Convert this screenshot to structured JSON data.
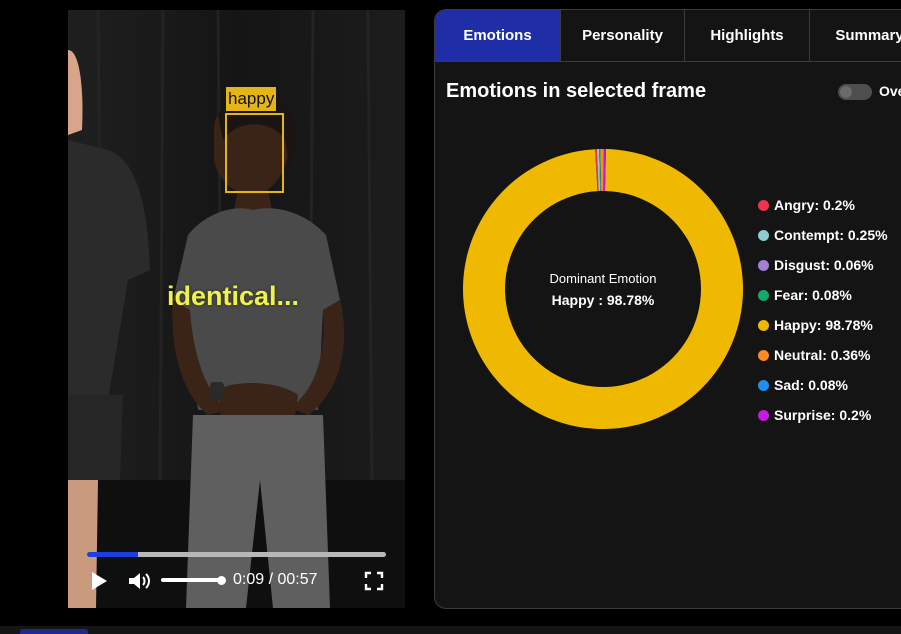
{
  "video": {
    "face_label": "happy",
    "caption": "identical...",
    "time_current": "0:09",
    "time_total": "00:57",
    "progress": 0.17,
    "volume": 0.95
  },
  "tabs": [
    {
      "label": "Emotions",
      "active": true
    },
    {
      "label": "Personality",
      "active": false
    },
    {
      "label": "Highlights",
      "active": false
    },
    {
      "label": "Summary",
      "active": false
    }
  ],
  "panel": {
    "title": "Emotions in selected frame",
    "toggle_label": "Ove",
    "toggle_on": false
  },
  "chart_data": {
    "type": "pie",
    "style": "donut",
    "center_caption": "Dominant Emotion",
    "dominant": "Happy : 98.78%",
    "categories": [
      "Angry",
      "Contempt",
      "Disgust",
      "Fear",
      "Happy",
      "Neutral",
      "Sad",
      "Surprise"
    ],
    "values": [
      0.2,
      0.25,
      0.06,
      0.08,
      98.78,
      0.36,
      0.08,
      0.2
    ],
    "labels": [
      "Angry: 0.2%",
      "Contempt: 0.25%",
      "Disgust: 0.06%",
      "Fear: 0.08%",
      "Happy: 98.78%",
      "Neutral: 0.36%",
      "Sad: 0.08%",
      "Surprise: 0.2%"
    ],
    "colors": [
      "#f0334b",
      "#8ecbcf",
      "#a280d6",
      "#15a86b",
      "#eeb900",
      "#fb8b1c",
      "#1e8ff0",
      "#c31ae6"
    ],
    "legend": "right"
  },
  "icons": {
    "play": "play-icon",
    "volume": "volume-icon",
    "fullscreen": "fullscreen-icon"
  }
}
